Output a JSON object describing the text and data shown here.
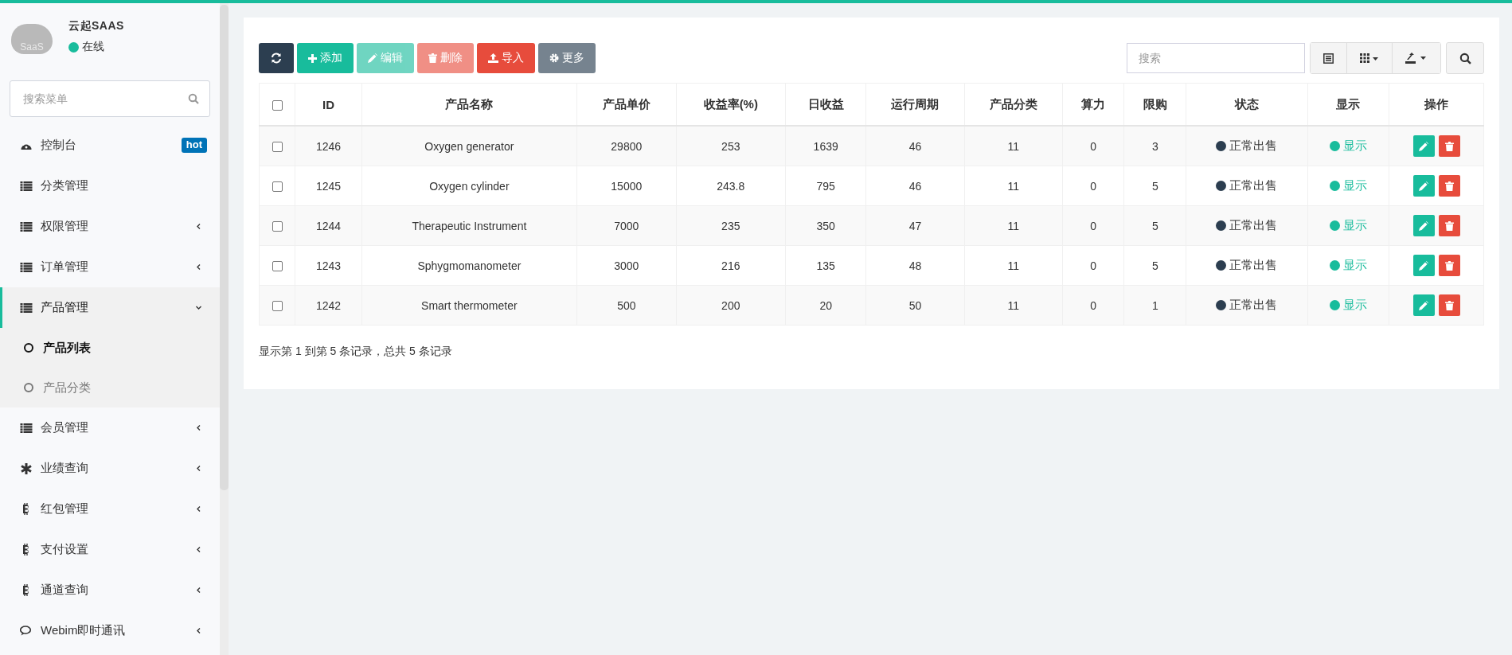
{
  "sidebar": {
    "brand": "云起SAAS",
    "avatar_text": "SaaS",
    "status": {
      "label": "在线",
      "online": true
    },
    "search": {
      "placeholder": "搜索菜单"
    },
    "menu": [
      {
        "label": "控制台",
        "badge": "hot",
        "submenu": false,
        "expanded": false
      },
      {
        "label": "分类管理",
        "submenu": false,
        "expanded": false
      },
      {
        "label": "权限管理",
        "submenu": true,
        "expanded": false
      },
      {
        "label": "订单管理",
        "submenu": true,
        "expanded": false
      },
      {
        "label": "产品管理",
        "submenu": true,
        "expanded": true,
        "children": [
          {
            "label": "产品列表",
            "selected": true
          },
          {
            "label": "产品分类",
            "selected": false
          }
        ]
      },
      {
        "label": "会员管理",
        "submenu": true,
        "expanded": false
      },
      {
        "label": "业绩查询",
        "submenu": true,
        "expanded": false
      },
      {
        "label": "红包管理",
        "submenu": true,
        "expanded": false
      },
      {
        "label": "支付设置",
        "submenu": true,
        "expanded": false
      },
      {
        "label": "通道查询",
        "submenu": true,
        "expanded": false
      },
      {
        "label": "Webim即时通讯",
        "submenu": true,
        "expanded": false
      }
    ]
  },
  "toolbar": {
    "buttons": [
      {
        "kind": "refresh",
        "disabled": false
      },
      {
        "kind": "add",
        "label": "添加",
        "disabled": false
      },
      {
        "kind": "edit",
        "label": "编辑",
        "disabled": true
      },
      {
        "kind": "delete",
        "label": "删除",
        "disabled": true
      },
      {
        "kind": "import",
        "label": "导入",
        "disabled": false
      },
      {
        "kind": "more",
        "label": "更多",
        "disabled": false
      }
    ],
    "search": {
      "placeholder": "搜索"
    }
  },
  "table": {
    "select_all_checked": false,
    "columns": [
      "ID",
      "产品名称",
      "产品单价",
      "收益率(%)",
      "日收益",
      "运行周期",
      "产品分类",
      "算力",
      "限购",
      "状态",
      "显示",
      "操作"
    ],
    "rows": [
      {
        "checked": false,
        "cells": [
          "1246",
          "Oxygen generator",
          "29800",
          "253",
          "1639",
          "46",
          "11",
          "0",
          "3"
        ],
        "status": "正常出售",
        "display": "显示"
      },
      {
        "checked": false,
        "cells": [
          "1245",
          "Oxygen cylinder",
          "15000",
          "243.8",
          "795",
          "46",
          "11",
          "0",
          "5"
        ],
        "status": "正常出售",
        "display": "显示"
      },
      {
        "checked": false,
        "cells": [
          "1244",
          "Therapeutic Instrument",
          "7000",
          "235",
          "350",
          "47",
          "11",
          "0",
          "5"
        ],
        "status": "正常出售",
        "display": "显示"
      },
      {
        "checked": false,
        "cells": [
          "1243",
          "Sphygmomanometer",
          "3000",
          "216",
          "135",
          "48",
          "11",
          "0",
          "5"
        ],
        "status": "正常出售",
        "display": "显示"
      },
      {
        "checked": false,
        "cells": [
          "1242",
          "Smart thermometer",
          "500",
          "200",
          "20",
          "50",
          "11",
          "0",
          "1"
        ],
        "status": "正常出售",
        "display": "显示"
      }
    ]
  },
  "pagination_info": "显示第 1 到第 5 条记录，总共 5 条记录"
}
